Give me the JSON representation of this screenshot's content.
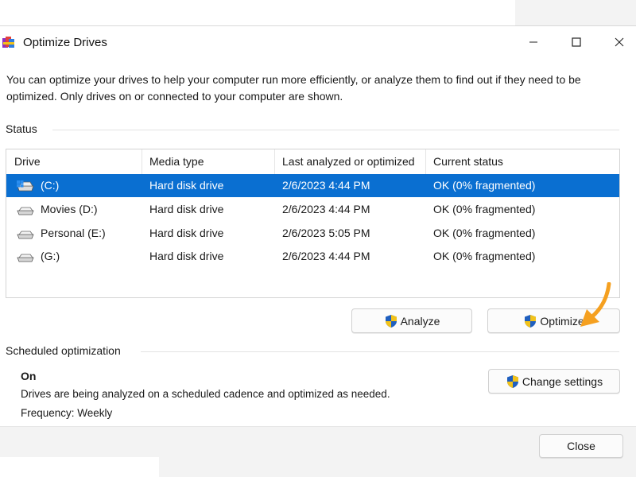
{
  "window": {
    "title": "Optimize Drives",
    "controls": {
      "minimize": "minimize-icon",
      "maximize": "maximize-icon",
      "close": "close-icon"
    }
  },
  "intro_text": "You can optimize your drives to help your computer run more efficiently, or analyze them to find out if they need to be optimized. Only drives on or connected to your computer are shown.",
  "status": {
    "label": "Status",
    "columns": [
      "Drive",
      "Media type",
      "Last analyzed or optimized",
      "Current status"
    ],
    "drives": [
      {
        "name": "(C:)",
        "media_type": "Hard disk drive",
        "last_run": "2/6/2023 4:44 PM",
        "status": "OK (0% fragmented)",
        "selected": true,
        "icon": "system-drive-icon"
      },
      {
        "name": "Movies (D:)",
        "media_type": "Hard disk drive",
        "last_run": "2/6/2023 4:44 PM",
        "status": "OK (0% fragmented)",
        "selected": false,
        "icon": "drive-icon"
      },
      {
        "name": "Personal (E:)",
        "media_type": "Hard disk drive",
        "last_run": "2/6/2023 5:05 PM",
        "status": "OK (0% fragmented)",
        "selected": false,
        "icon": "drive-icon"
      },
      {
        "name": "(G:)",
        "media_type": "Hard disk drive",
        "last_run": "2/6/2023 4:44 PM",
        "status": "OK (0% fragmented)",
        "selected": false,
        "icon": "drive-icon"
      }
    ],
    "analyze_label": "Analyze",
    "optimize_label": "Optimize"
  },
  "scheduled": {
    "label": "Scheduled optimization",
    "state": "On",
    "description": "Drives are being analyzed on a scheduled cadence and optimized as needed.",
    "frequency": "Frequency: Weekly",
    "change_settings_label": "Change settings"
  },
  "footer": {
    "close_label": "Close"
  },
  "colors": {
    "selection": "#0a6fd1",
    "annotation_arrow": "#f5a020",
    "shield_blue": "#1f5fbf",
    "shield_yellow": "#f2c21a"
  }
}
